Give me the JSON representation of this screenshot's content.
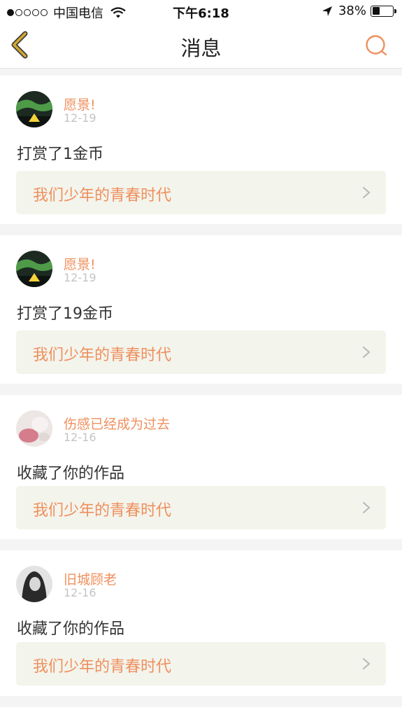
{
  "status": {
    "carrier": "中国电信",
    "time": "下午6:18",
    "battery": "38%",
    "battery_level": 0.38,
    "signal_dots": 5,
    "signal_filled": 1
  },
  "nav": {
    "title": "消息"
  },
  "colors": {
    "accent": "#ef8f5d",
    "back_icon": "#d3a830"
  },
  "messages": [
    {
      "user": "愿景!",
      "date": "12-19",
      "action": "打赏了1金币",
      "work": "我们少年的青春时代",
      "avatar": "aurora-tent"
    },
    {
      "user": "愿景!",
      "date": "12-19",
      "action": "打赏了19金币",
      "work": "我们少年的青春时代",
      "avatar": "aurora-tent"
    },
    {
      "user": "伤感已经成为过去",
      "date": "12-16",
      "action": "收藏了你的作品",
      "work": "我们少年的青春时代",
      "avatar": "pink-cup"
    },
    {
      "user": "旧城顾老",
      "date": "12-16",
      "action": "收藏了你的作品",
      "work": "我们少年的青春时代",
      "avatar": "grey-portrait"
    }
  ]
}
